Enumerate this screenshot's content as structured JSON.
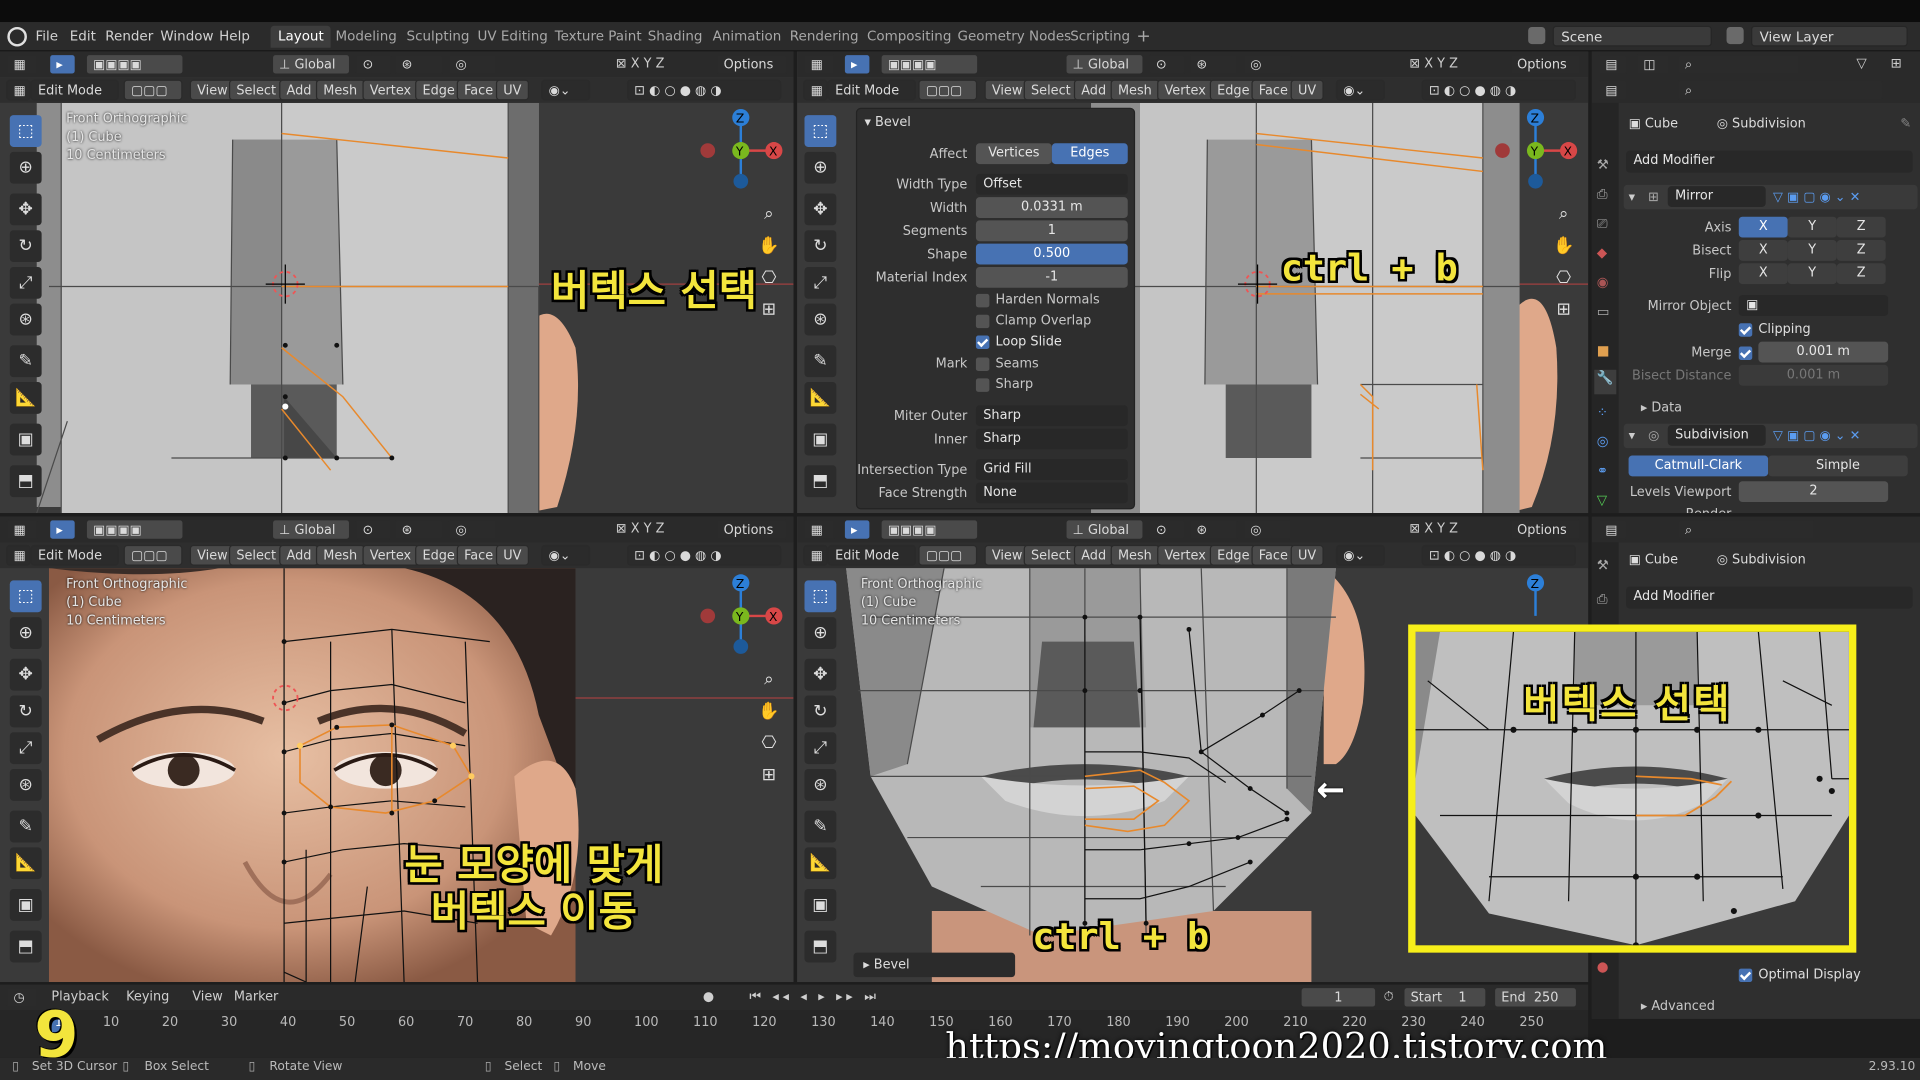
{
  "menubar": {
    "items": [
      "File",
      "Edit",
      "Render",
      "Window",
      "Help"
    ],
    "workspaces": [
      "Layout",
      "Modeling",
      "Sculpting",
      "UV Editing",
      "Texture Paint",
      "Shading",
      "Animation",
      "Rendering",
      "Compositing",
      "Geometry Nodes",
      "Scripting"
    ],
    "active_workspace": "Layout",
    "scene": "Scene",
    "view_layer": "View Layer"
  },
  "viewport_header": {
    "mode": "Edit Mode",
    "menus": [
      "View",
      "Select",
      "Add",
      "Mesh",
      "Vertex",
      "Edge",
      "Face",
      "UV"
    ],
    "transform": "Global",
    "options": "Options",
    "axes": [
      "X",
      "Y",
      "Z"
    ]
  },
  "overlay": {
    "view_name": "Front Orthographic",
    "object": "(1) Cube",
    "scale": "10 Centimeters"
  },
  "annotations": {
    "vertex_select": "버텍스 선택",
    "ctrl_b": "ctrl + b",
    "move_vertices_line1": "눈 모양에 맞게",
    "move_vertices_line2": "버텍스 이동",
    "step_number": "9",
    "website": "https://movingtoon2020.tistory.com",
    "arrow": "←"
  },
  "bevel_panel": {
    "title": "Bevel",
    "affect_label": "Affect",
    "affect_options": [
      "Vertices",
      "Edges"
    ],
    "affect_selected": "Edges",
    "width_type_label": "Width Type",
    "width_type": "Offset",
    "width_label": "Width",
    "width": "0.0331 m",
    "segments_label": "Segments",
    "segments": "1",
    "shape_label": "Shape",
    "shape": "0.500",
    "material_index_label": "Material Index",
    "material_index": "-1",
    "harden_normals": "Harden Normals",
    "clamp_overlap": "Clamp Overlap",
    "loop_slide": "Loop Slide",
    "mark_label": "Mark",
    "seams": "Seams",
    "sharp": "Sharp",
    "miter_outer_label": "Miter Outer",
    "miter_outer": "Sharp",
    "inner_label": "Inner",
    "inner": "Sharp",
    "intersection_type_label": "Intersection Type",
    "intersection_type": "Grid Fill",
    "face_strength_label": "Face Strength",
    "face_strength": "None",
    "collapsed_label": "Bevel"
  },
  "properties": {
    "object": "Cube",
    "modifier_tab": "Subdivision",
    "add_modifier": "Add Modifier",
    "mirror": {
      "name": "Mirror",
      "axis_label": "Axis",
      "bisect_label": "Bisect",
      "flip_label": "Flip",
      "mirror_object_label": "Mirror Object",
      "clipping": "Clipping",
      "merge_label": "Merge",
      "merge": "0.001 m",
      "bisect_distance_label": "Bisect Distance",
      "bisect_distance": "0.001 m",
      "data": "Data"
    },
    "subdivision": {
      "name": "Subdivision",
      "catmull": "Catmull-Clark",
      "simple": "Simple",
      "levels_viewport_label": "Levels Viewport",
      "levels_viewport": "2",
      "render_label": "Render",
      "optimal_display": "Optimal Display",
      "advanced": "Advanced"
    }
  },
  "timeline": {
    "playback": "Playback",
    "keying": "Keying",
    "view": "View",
    "marker": "Marker",
    "current_frame": "1",
    "start_label": "Start",
    "start": "1",
    "end_label": "End",
    "end": "250",
    "ticks": [
      "10",
      "20",
      "30",
      "40",
      "50",
      "60",
      "70",
      "80",
      "90",
      "100",
      "110",
      "120",
      "130",
      "140",
      "150",
      "160",
      "170",
      "180",
      "190",
      "200",
      "210",
      "220",
      "230",
      "240",
      "250"
    ]
  },
  "statusbar": {
    "set_cursor": "Set 3D Cursor",
    "box_select": "Box Select",
    "rotate_view": "Rotate View",
    "select": "Select",
    "move": "Move",
    "version": "2.93.10"
  },
  "colors": {
    "accent": "#4772b3",
    "annotation": "#f3e53c",
    "selected_edge": "#e8892c",
    "highlight_frame": "#f7ef1a"
  }
}
